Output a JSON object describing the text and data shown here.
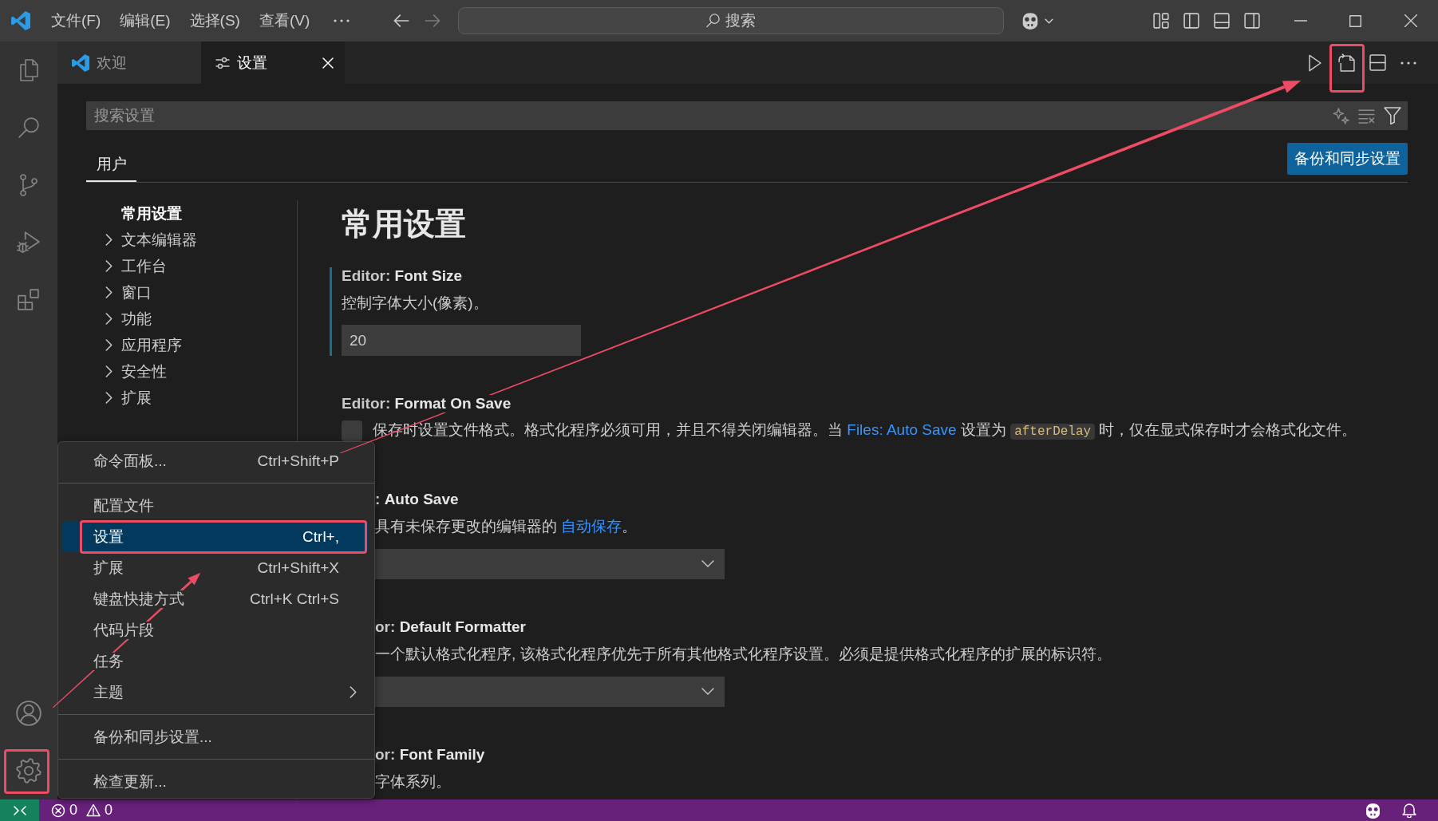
{
  "title_bar": {
    "menus": [
      {
        "label": "文件(F)"
      },
      {
        "label": "编辑(E)"
      },
      {
        "label": "选择(S)"
      },
      {
        "label": "查看(V)"
      }
    ],
    "nav_buttons": [
      {
        "kind": "back",
        "disabled": false
      },
      {
        "kind": "forward",
        "disabled": true
      }
    ],
    "command_center": {
      "label": "搜索"
    }
  },
  "activity_bar": {
    "top": [
      {
        "kind": "explorer",
        "annotated": false,
        "arrow": false
      },
      {
        "kind": "search",
        "annotated": false,
        "arrow": false
      },
      {
        "kind": "source-control",
        "annotated": false,
        "arrow": false
      },
      {
        "kind": "run-debug",
        "annotated": false,
        "arrow": false
      },
      {
        "kind": "extensions",
        "annotated": false,
        "arrow": false
      }
    ],
    "bottom": [
      {
        "kind": "account",
        "annotated": false,
        "arrow": false
      },
      {
        "kind": "manage",
        "annotated": true,
        "arrow": true
      }
    ]
  },
  "tabs": [
    {
      "kind": "welcome",
      "label": "欢迎",
      "selected": false
    },
    {
      "kind": "settings",
      "label": "设置",
      "selected": true
    }
  ],
  "editor_actions": [
    {
      "kind": "run",
      "annotated": false,
      "arrow": false
    },
    {
      "kind": "open-json",
      "annotated": true,
      "arrow": true
    },
    {
      "kind": "split",
      "annotated": false,
      "arrow": false
    },
    {
      "kind": "more",
      "annotated": false,
      "arrow": false
    }
  ],
  "settings_editor": {
    "search": {
      "placeholder": "搜索设置"
    },
    "scope_tabs": [
      {
        "label": "用户",
        "selected": true
      }
    ],
    "sync_button": {
      "label": "备份和同步设置"
    },
    "toc": [
      {
        "kind": "leaf",
        "label": "常用设置",
        "selected": true
      },
      {
        "kind": "group",
        "label": "文本编辑器",
        "selected": false
      },
      {
        "kind": "group",
        "label": "工作台",
        "selected": false
      },
      {
        "kind": "group",
        "label": "窗口",
        "selected": false
      },
      {
        "kind": "group",
        "label": "功能",
        "selected": false
      },
      {
        "kind": "group",
        "label": "应用程序",
        "selected": false
      },
      {
        "kind": "group",
        "label": "安全性",
        "selected": false
      },
      {
        "kind": "group",
        "label": "扩展",
        "selected": false
      }
    ],
    "section_title": "常用设置",
    "settings": [
      {
        "kind": "number",
        "covered": false,
        "focused": true,
        "category": "Editor:",
        "name": "Font Size",
        "description": [
          {
            "kind": "text",
            "text": "控制字体大小(像素)。"
          }
        ],
        "value": "20"
      },
      {
        "kind": "checkbox",
        "covered": false,
        "focused": false,
        "category": "Editor:",
        "name": "Format On Save",
        "checked": false,
        "description": [
          {
            "kind": "text",
            "text": "保存时设置文件格式。格式化程序必须可用，并且不得关闭编辑器。当 "
          },
          {
            "kind": "link",
            "text": "Files: Auto Save"
          },
          {
            "kind": "text",
            "text": " 设置为 "
          },
          {
            "kind": "code",
            "text": "afterDelay"
          },
          {
            "kind": "text",
            "text": " 时，仅在显式保存时才会格式化文件。"
          }
        ]
      },
      {
        "kind": "dropdown",
        "covered": true,
        "focused": false,
        "category": ":",
        "name": "Auto Save",
        "description": [
          {
            "kind": "text",
            "text": "具有未保存更改的编辑器的 "
          },
          {
            "kind": "link",
            "text": "自动保存"
          },
          {
            "kind": "text",
            "text": "。"
          }
        ]
      },
      {
        "kind": "dropdown",
        "covered": true,
        "focused": false,
        "category": "or:",
        "name": "Default Formatter",
        "description": [
          {
            "kind": "text",
            "text": "一个默认格式化程序, 该格式化程序优先于所有其他格式化程序设置。必须是提供格式化程序的扩展的标识符。"
          }
        ]
      },
      {
        "kind": "string",
        "covered": true,
        "focused": false,
        "category": "or:",
        "name": "Font Family",
        "description": [
          {
            "kind": "text",
            "text": "字体系列。"
          }
        ]
      }
    ]
  },
  "menu": {
    "groups": [
      [
        {
          "label": "命令面板...",
          "shortcut": "Ctrl+Shift+P",
          "selected": false,
          "annotated": false,
          "submenu": false
        }
      ],
      [
        {
          "label": "配置文件",
          "selected": false,
          "annotated": false,
          "submenu": false
        },
        {
          "label": "设置",
          "shortcut": "Ctrl+,",
          "selected": true,
          "annotated": true,
          "submenu": false
        },
        {
          "label": "扩展",
          "shortcut": "Ctrl+Shift+X",
          "selected": false,
          "annotated": false,
          "submenu": false
        },
        {
          "label": "键盘快捷方式",
          "shortcut": "Ctrl+K Ctrl+S",
          "selected": false,
          "annotated": false,
          "submenu": false
        },
        {
          "label": "代码片段",
          "selected": false,
          "annotated": false,
          "submenu": false
        },
        {
          "label": "任务",
          "selected": false,
          "annotated": false,
          "submenu": false
        },
        {
          "label": "主题",
          "selected": false,
          "annotated": false,
          "submenu": true
        }
      ],
      [
        {
          "label": "备份和同步设置...",
          "selected": false,
          "annotated": false,
          "submenu": false
        }
      ],
      [
        {
          "label": "检查更新...",
          "selected": false,
          "annotated": false,
          "submenu": false
        }
      ]
    ]
  },
  "status_bar": {
    "errors": "0",
    "warnings": "0"
  }
}
